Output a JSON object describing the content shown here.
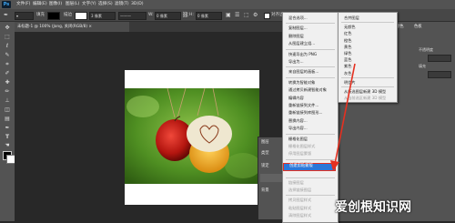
{
  "app": {
    "logo": "Ps"
  },
  "menubar": {
    "items": [
      "文件(F)",
      "编辑(E)",
      "图像(I)",
      "图层(L)",
      "文字(Y)",
      "选择(S)",
      "滤镜(T)",
      "3D(D)"
    ]
  },
  "options": {
    "fill_label": "填充",
    "stroke_label": "描边",
    "stroke_size": "3 像素",
    "w_label": "W:",
    "w_value": "0 像素",
    "h_label": "H:",
    "h_value": "0 像素",
    "align_label": "对齐边缘"
  },
  "document": {
    "tab_title": "未标题-1 @ 100% (Jong, 关闭(RGB/8) ×"
  },
  "layers_panel": {
    "title": "图层",
    "kind_label": "类型",
    "lock_label": "锁定",
    "bg_label": "背景"
  },
  "panels": {
    "tab_1": "颜色",
    "tab_2": "色板",
    "label_a": "不透明度",
    "label_b": "填充"
  },
  "context_menu_main": {
    "items": [
      {
        "label": "混合选项...",
        "disabled": false
      },
      {
        "label": "复制图层...",
        "disabled": false
      },
      {
        "label": "删除图层",
        "disabled": false
      },
      {
        "label": "从图层建立组...",
        "disabled": false
      },
      {
        "label": "快速导出为 PNG",
        "disabled": false
      },
      {
        "label": "导出为...",
        "disabled": false
      },
      {
        "label": "来自图层的画板...",
        "disabled": false
      },
      {
        "label": "转换为智能对象",
        "disabled": false
      },
      {
        "label": "通过拷贝新建智能对象",
        "disabled": false
      },
      {
        "label": "编辑内容",
        "disabled": false
      },
      {
        "label": "重新链接到文件...",
        "disabled": false
      },
      {
        "label": "重新链接到库图形...",
        "disabled": false
      },
      {
        "label": "替换内容...",
        "disabled": false
      },
      {
        "label": "导出内容...",
        "disabled": false
      },
      {
        "label": "栅格化图层",
        "disabled": false
      },
      {
        "label": "栅格化图层样式",
        "disabled": true
      },
      {
        "label": "停用图层蒙版",
        "disabled": true
      },
      {
        "label": "启用矢量蒙版",
        "disabled": true
      },
      {
        "label": "创建剪贴蒙版",
        "disabled": false,
        "highlighted": true
      },
      {
        "label": "链接图层",
        "disabled": true
      },
      {
        "label": "选择链接图层",
        "disabled": true
      },
      {
        "label": "拷贝图层样式",
        "disabled": true
      },
      {
        "label": "粘贴图层样式",
        "disabled": true
      },
      {
        "label": "清除图层样式",
        "disabled": true
      }
    ]
  },
  "context_menu_sub": {
    "items": [
      {
        "label": "合并图层",
        "disabled": false
      },
      {
        "label": "无颜色",
        "disabled": false
      },
      {
        "label": "红色",
        "disabled": false
      },
      {
        "label": "橙色",
        "disabled": false
      },
      {
        "label": "黄色",
        "disabled": false
      },
      {
        "label": "绿色",
        "disabled": false
      },
      {
        "label": "蓝色",
        "disabled": false
      },
      {
        "label": "紫色",
        "disabled": false
      },
      {
        "label": "灰色",
        "disabled": false
      },
      {
        "label": "明信片",
        "disabled": false
      },
      {
        "label": "从所选图层新建 3D 模型",
        "disabled": false
      },
      {
        "label": "从当前选区新建 3D 模型",
        "disabled": true
      }
    ]
  },
  "watermark": {
    "text": "爱创根知识网"
  }
}
